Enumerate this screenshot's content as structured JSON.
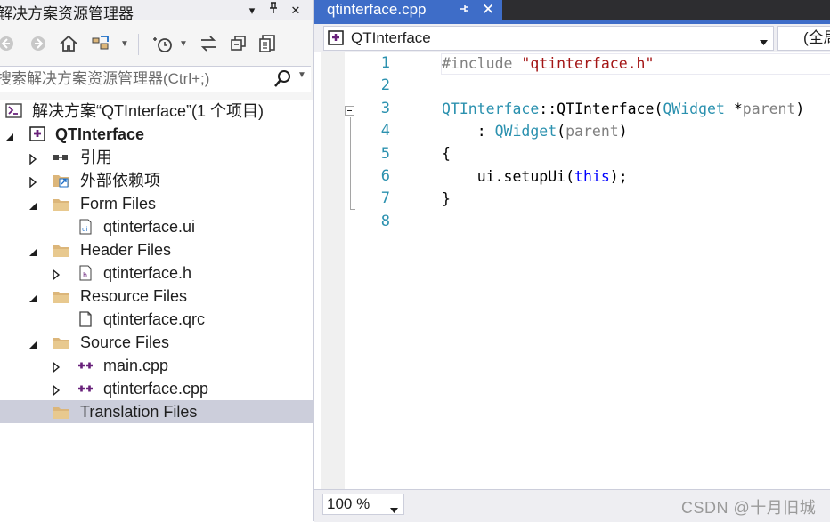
{
  "solution_explorer": {
    "title": "解决方案资源管理器",
    "title_buttons": {
      "dropdown": "▾",
      "pin": "ᛘ",
      "close": "✕"
    },
    "toolbar": {
      "icons": [
        "back-icon",
        "forward-icon",
        "home-icon",
        "switch-views-icon",
        "history-icon",
        "sync-icon",
        "collapse-all-icon",
        "properties-icon"
      ]
    },
    "search": {
      "placeholder": "搜索解决方案资源管理器(Ctrl+;)",
      "value": ""
    },
    "tree": [
      {
        "label": "解决方案“QTInterface”(1 个项目)",
        "icon": "solution-icon",
        "expander": "none"
      },
      {
        "label": "QTInterface",
        "icon": "qt-project-icon",
        "expander": "expanded",
        "bold": true
      },
      {
        "label": "引用",
        "icon": "references-icon",
        "expander": "collapsed"
      },
      {
        "label": "外部依赖项",
        "icon": "external-deps-icon",
        "expander": "collapsed"
      },
      {
        "label": "Form Files",
        "icon": "folder-icon",
        "expander": "expanded"
      },
      {
        "label": "qtinterface.ui",
        "icon": "ui-file-icon",
        "expander": "none"
      },
      {
        "label": "Header Files",
        "icon": "folder-icon",
        "expander": "expanded"
      },
      {
        "label": "qtinterface.h",
        "icon": "header-file-icon",
        "expander": "collapsed"
      },
      {
        "label": "Resource Files",
        "icon": "folder-icon",
        "expander": "expanded"
      },
      {
        "label": "qtinterface.qrc",
        "icon": "file-icon",
        "expander": "none"
      },
      {
        "label": "Source Files",
        "icon": "folder-icon",
        "expander": "expanded"
      },
      {
        "label": "main.cpp",
        "icon": "cpp-file-icon",
        "expander": "collapsed"
      },
      {
        "label": "qtinterface.cpp",
        "icon": "cpp-file-icon",
        "expander": "collapsed"
      },
      {
        "label": "Translation Files",
        "icon": "folder-icon",
        "expander": "none",
        "selected": true
      }
    ]
  },
  "editor": {
    "tab": {
      "name": "qtinterface.cpp",
      "close": "✕"
    },
    "nav": {
      "scope": "QTInterface",
      "scope2": "(全局"
    },
    "line_numbers": [
      "1",
      "2",
      "3",
      "4",
      "5",
      "6",
      "7",
      "8"
    ],
    "code": {
      "l1_pre": "#include",
      "l1_str": "\"qtinterface.h\"",
      "l3_type": "QTInterface",
      "l3_sep": "::",
      "l3_fn": "QTInterface",
      "l3_open": "(",
      "l3_ptype": "QWidget",
      "l3_star": " *",
      "l3_param": "parent",
      "l3_close": ")",
      "l4_colon": "    : ",
      "l4_type": "QWidget",
      "l4_open": "(",
      "l4_param": "parent",
      "l4_close": ")",
      "l5": "{",
      "l6_pre": "    ui.setupUi(",
      "l6_kw": "this",
      "l6_post": ");",
      "l7": "}"
    },
    "zoom": "100 %"
  },
  "watermark": "CSDN @十月旧城",
  "colors": {
    "accent": "#3e6dc8",
    "selection": "#cccedb",
    "type": "#2b91af",
    "string": "#a31515",
    "keyword": "#0000ff",
    "preprocessor": "#808080"
  }
}
